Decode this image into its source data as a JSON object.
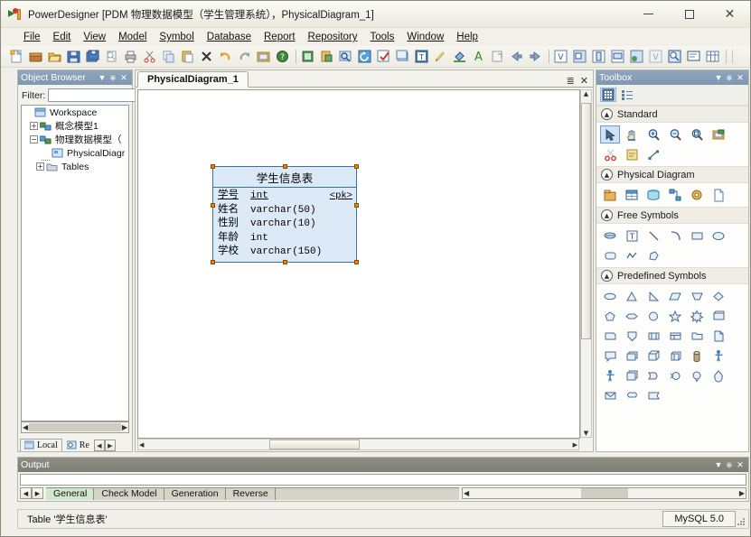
{
  "window": {
    "title": "PowerDesigner [PDM 物理数据模型（学生管理系统），PhysicalDiagram_1]",
    "app_icon": "powerdesigner-icon",
    "minimize": "minimize-icon",
    "maximize": "maximize-icon",
    "close": "close-icon"
  },
  "menu": [
    {
      "label": "File"
    },
    {
      "label": "Edit"
    },
    {
      "label": "View"
    },
    {
      "label": "Model"
    },
    {
      "label": "Symbol"
    },
    {
      "label": "Database"
    },
    {
      "label": "Report"
    },
    {
      "label": "Repository"
    },
    {
      "label": "Tools"
    },
    {
      "label": "Window"
    },
    {
      "label": "Help"
    }
  ],
  "toolbar": {
    "groups": [
      [
        "new-model-icon",
        "new-package-icon",
        "open-icon",
        "save-icon",
        "save-all-icon",
        "print-preview-icon",
        "print-icon",
        "cut-icon",
        "copy-icon",
        "paste-icon",
        "delete-icon",
        "undo-icon",
        "redo-icon",
        "properties-icon",
        "help-icon"
      ],
      [
        "new-object-icon",
        "paste-object-icon",
        "find-object-icon",
        "refresh-icon",
        "check-model-icon",
        "symbol-format-icon",
        "display-preferences-icon",
        "pencil-icon",
        "fill-color-icon",
        "font-color-icon",
        "clipboard-export-icon",
        "previous-icon",
        "next-icon"
      ],
      [
        "zoom-in-view-icon",
        "zoom-window-icon",
        "zoom-page-icon",
        "zoom-width-icon",
        "zoom-selection-icon",
        "zoom-fit-icon",
        "browse-icon",
        "comment-icon",
        "grid-icon"
      ]
    ]
  },
  "browser": {
    "title": "Object Browser",
    "dropdown_icon": "chevron-down-icon",
    "pin_icon": "pin-icon",
    "close_icon": "close-icon",
    "filter_label": "Filter:",
    "filter_value": "",
    "filter_placeholder": "",
    "tree": [
      {
        "label": "Workspace",
        "icon": "workspace-icon",
        "toggle": "none",
        "indent": 0
      },
      {
        "label": "概念模型1",
        "icon": "cdm-model-icon",
        "toggle": "+",
        "indent": 1
      },
      {
        "label": "物理数据模型（",
        "icon": "pdm-model-icon",
        "toggle": "-",
        "indent": 1
      },
      {
        "label": "PhysicalDiagr",
        "icon": "diagram-icon",
        "toggle": "none",
        "indent": 2
      },
      {
        "label": "Tables",
        "icon": "folder-icon",
        "toggle": "+",
        "indent": 2
      }
    ],
    "tabs": [
      {
        "label": "Local",
        "icon": "local-icon",
        "active": true
      },
      {
        "label": "Re",
        "icon": "repository-icon",
        "active": false
      }
    ]
  },
  "document": {
    "tab_label": "PhysicalDiagram_1",
    "tab_menu_icon": "tab-list-icon",
    "tab_close_icon": "close-icon",
    "table": {
      "name": "学生信息表",
      "columns": [
        {
          "name": "学号",
          "type": "int",
          "key": "<pk>",
          "pk": true
        },
        {
          "name": "姓名",
          "type": "varchar(50)",
          "key": "",
          "pk": false
        },
        {
          "name": "性别",
          "type": "varchar(10)",
          "key": "",
          "pk": false
        },
        {
          "name": "年龄",
          "type": "int",
          "key": "",
          "pk": false
        },
        {
          "name": "学校",
          "type": "varchar(150)",
          "key": "",
          "pk": false
        }
      ],
      "selected": true,
      "border_color": "#3b6fa8",
      "fill_color": "#dce9f7",
      "handle_color": "#f0820a"
    }
  },
  "toolbox": {
    "title": "Toolbox",
    "dropdown_icon": "chevron-down-icon",
    "pin_icon": "pin-icon",
    "close_icon": "close-icon",
    "view_buttons": [
      {
        "icon": "grid-view-icon",
        "selected": true
      },
      {
        "icon": "list-view-icon",
        "selected": false
      }
    ],
    "groups": [
      {
        "name": "Standard",
        "collapse_icon": "chevron-up-icon",
        "tools": [
          {
            "icon": "pointer-icon",
            "selected": true
          },
          {
            "icon": "grabber-hand-icon",
            "selected": false
          },
          {
            "icon": "zoom-in-icon",
            "selected": false
          },
          {
            "icon": "zoom-out-icon",
            "selected": false
          },
          {
            "icon": "zoom-area-icon",
            "selected": false
          },
          {
            "icon": "properties-icon",
            "selected": false
          },
          {
            "icon": "delete-scissors-icon",
            "selected": false
          },
          {
            "icon": "note-icon",
            "selected": false
          },
          {
            "icon": "link-icon",
            "selected": false
          }
        ]
      },
      {
        "name": "Physical Diagram",
        "collapse_icon": "chevron-up-icon",
        "tools": [
          {
            "icon": "package-icon",
            "selected": false
          },
          {
            "icon": "table-icon",
            "selected": false
          },
          {
            "icon": "view-icon",
            "selected": false
          },
          {
            "icon": "reference-icon",
            "selected": false
          },
          {
            "icon": "procedure-icon",
            "selected": false
          },
          {
            "icon": "file-icon",
            "selected": false
          }
        ]
      },
      {
        "name": "Free Symbols",
        "collapse_icon": "chevron-up-icon",
        "tools": [
          {
            "icon": "free-symbol-icon",
            "selected": false
          },
          {
            "icon": "text-icon",
            "selected": false
          },
          {
            "icon": "line-icon",
            "selected": false
          },
          {
            "icon": "arc-icon",
            "selected": false
          },
          {
            "icon": "rectangle-icon",
            "selected": false
          },
          {
            "icon": "ellipse-icon",
            "selected": false
          },
          {
            "icon": "rounded-rect-icon",
            "selected": false
          },
          {
            "icon": "polyline-icon",
            "selected": false
          },
          {
            "icon": "polygon-icon",
            "selected": false
          }
        ]
      },
      {
        "name": "Predefined Symbols",
        "collapse_icon": "chevron-up-icon",
        "tools": [
          {
            "icon": "oval-icon",
            "selected": false
          },
          {
            "icon": "triangle-icon",
            "selected": false
          },
          {
            "icon": "right-triangle-icon",
            "selected": false
          },
          {
            "icon": "parallelogram-icon",
            "selected": false
          },
          {
            "icon": "trapezoid-icon",
            "selected": false
          },
          {
            "icon": "diamond-icon",
            "selected": false
          },
          {
            "icon": "pentagon-icon",
            "selected": false
          },
          {
            "icon": "hexagon-flat-icon",
            "selected": false
          },
          {
            "icon": "circle-icon",
            "selected": false
          },
          {
            "icon": "star-icon",
            "selected": false
          },
          {
            "icon": "burst-icon",
            "selected": false
          },
          {
            "icon": "card-icon",
            "selected": false
          },
          {
            "icon": "corner-box-icon",
            "selected": false
          },
          {
            "icon": "shield-icon",
            "selected": false
          },
          {
            "icon": "window-icon",
            "selected": false
          },
          {
            "icon": "table-box-icon",
            "selected": false
          },
          {
            "icon": "folder-shape-icon",
            "selected": false
          },
          {
            "icon": "document-shape-icon",
            "selected": false
          },
          {
            "icon": "callout-icon",
            "selected": false
          },
          {
            "icon": "stack-icon",
            "selected": false
          },
          {
            "icon": "cube-icon",
            "selected": false
          },
          {
            "icon": "box3d-icon",
            "selected": false
          },
          {
            "icon": "cylinder-icon",
            "selected": false
          },
          {
            "icon": "actor-icon",
            "selected": false
          },
          {
            "icon": "actor2-icon",
            "selected": false
          },
          {
            "icon": "multi-rect-icon",
            "selected": false
          },
          {
            "icon": "arrow-shape-icon",
            "selected": false
          },
          {
            "icon": "circle-arrow-icon",
            "selected": false
          },
          {
            "icon": "balloon-icon",
            "selected": false
          },
          {
            "icon": "drop-icon",
            "selected": false
          },
          {
            "icon": "envelope-icon",
            "selected": false
          },
          {
            "icon": "cloud-icon",
            "selected": false
          },
          {
            "icon": "flag-icon",
            "selected": false
          }
        ]
      }
    ]
  },
  "output": {
    "title": "Output",
    "dropdown_icon": "chevron-down-icon",
    "pin_icon": "pin-icon",
    "close_icon": "close-icon",
    "text": "",
    "prev_icon": "prev-arrow-icon",
    "next_icon": "next-arrow-icon",
    "tabs": [
      {
        "label": "General",
        "active": true
      },
      {
        "label": "Check Model",
        "active": false
      },
      {
        "label": "Generation",
        "active": false
      },
      {
        "label": "Reverse",
        "active": false
      }
    ]
  },
  "status": {
    "message": "Table '学生信息表'",
    "dbms": "MySQL 5.0"
  }
}
